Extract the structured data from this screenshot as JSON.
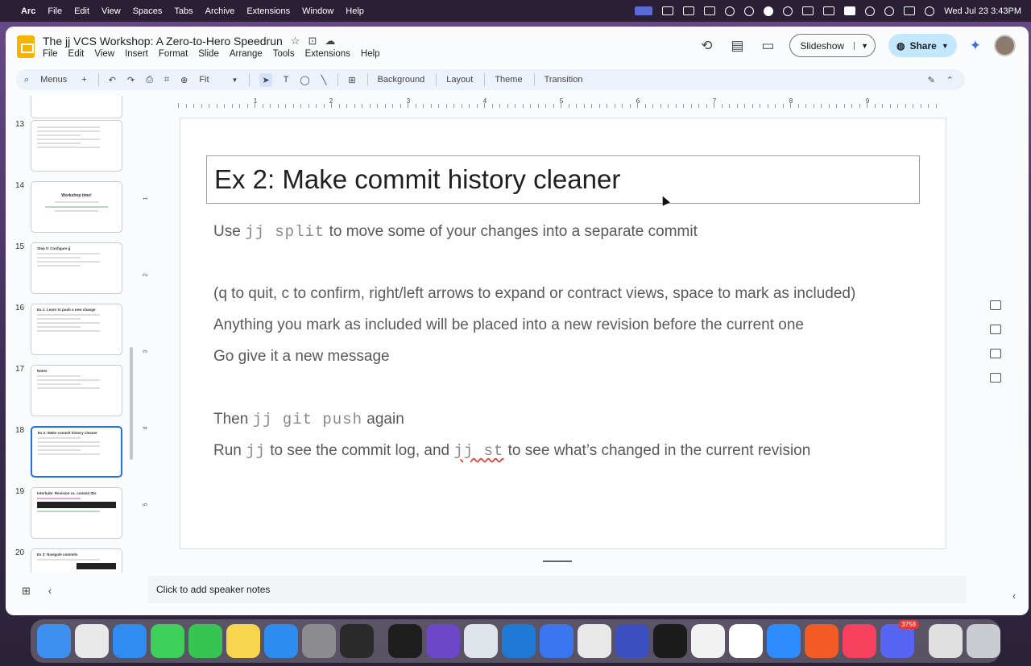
{
  "menubar": {
    "app_name": "Arc",
    "items": [
      "File",
      "Edit",
      "View",
      "Spaces",
      "Tabs",
      "Archive",
      "Extensions",
      "Window",
      "Help"
    ],
    "datetime": "Wed Jul 23  3:43PM"
  },
  "doc": {
    "title": "The jj VCS Workshop: A Zero-to-Hero Speedrun",
    "menus": [
      "File",
      "Edit",
      "View",
      "Insert",
      "Format",
      "Slide",
      "Arrange",
      "Tools",
      "Extensions",
      "Help"
    ],
    "slideshow_label": "Slideshow",
    "share_label": "Share"
  },
  "toolbar": {
    "menus_label": "Menus",
    "zoom": "Fit",
    "background_label": "Background",
    "layout_label": "Layout",
    "theme_label": "Theme",
    "transition_label": "Transition"
  },
  "ruler": {
    "h_labels": [
      "1",
      "2",
      "3",
      "4",
      "5",
      "6",
      "7",
      "8",
      "9"
    ],
    "v_labels": [
      "1",
      "2",
      "3",
      "4",
      "5"
    ]
  },
  "filmstrip": [
    {
      "num": "13",
      "title": "",
      "lines": 6
    },
    {
      "num": "14",
      "title": "Workshop time!",
      "lines": 3
    },
    {
      "num": "15",
      "title": "Step 0: Configure jj",
      "lines": 4
    },
    {
      "num": "16",
      "title": "Ex 1: Learn to push a new change",
      "lines": 6
    },
    {
      "num": "17",
      "title": "Notes",
      "lines": 5
    },
    {
      "num": "18",
      "title": "Ex 2: Make commit history cleaner",
      "lines": 5
    },
    {
      "num": "19",
      "title": "Interlude: Revision vs. commit IDs",
      "lines": 3
    },
    {
      "num": "20",
      "title": "Ex 3: Navigate commits",
      "lines": 2
    }
  ],
  "slide": {
    "title": "Ex 2: Make commit history cleaner",
    "line1": {
      "pre": "Use ",
      "code": "jj split",
      "post": " to move some of your changes into a separate commit"
    },
    "line2": "(q to quit, c to confirm, right/left arrows to expand or contract views, space to mark as included)",
    "line3": "Anything you mark as included will be placed into a new revision before the current one",
    "line4": "Go give it a new message",
    "line5": {
      "pre": "Then ",
      "code": "jj git push",
      "post": " again"
    },
    "line6": {
      "pre": "Run ",
      "code1": "jj",
      "mid": " to see the commit log, and ",
      "code2": "jj st",
      "post": " to see what’s changed in the current revision"
    }
  },
  "notes": {
    "placeholder": "Click to add speaker notes"
  },
  "dock": {
    "discord_badge": "3758",
    "apps": [
      {
        "name": "finder-icon",
        "color": "#3d8ff0"
      },
      {
        "name": "launchpad-icon",
        "color": "#e8e8e8"
      },
      {
        "name": "safari-icon",
        "color": "#2f8cf0"
      },
      {
        "name": "messages-icon",
        "color": "#3ecf5a"
      },
      {
        "name": "facetime-icon",
        "color": "#36c553"
      },
      {
        "name": "notes-icon",
        "color": "#f7d64d"
      },
      {
        "name": "app-store-icon",
        "color": "#2d8cf0"
      },
      {
        "name": "system-settings-icon",
        "color": "#8d8d91"
      },
      {
        "name": "layers-app-icon",
        "color": "#2a2a2a"
      },
      {
        "name": "cube-app-icon",
        "color": "#1e1e1e"
      },
      {
        "name": "orb-app-icon",
        "color": "#6c48c9"
      },
      {
        "name": "scope-app-icon",
        "color": "#dfe4ea"
      },
      {
        "name": "vscode-icon",
        "color": "#1f7ad6"
      },
      {
        "name": "signal-icon",
        "color": "#3a76f0"
      },
      {
        "name": "chrome-icon",
        "color": "#e8e8e8"
      },
      {
        "name": "affinity-icon",
        "color": "#3b4fc0"
      },
      {
        "name": "terminal-icon",
        "color": "#1b1b1b"
      },
      {
        "name": "textedit-icon",
        "color": "#f2f2f2"
      },
      {
        "name": "notion-icon",
        "color": "#ffffff"
      },
      {
        "name": "zoom-icon",
        "color": "#2d8cff"
      },
      {
        "name": "brave-icon",
        "color": "#f25b23"
      },
      {
        "name": "music-icon",
        "color": "#f6405e"
      },
      {
        "name": "discord-icon",
        "color": "#5865f2"
      },
      {
        "name": "archive-utility-icon",
        "color": "#e0e0e0"
      },
      {
        "name": "trash-icon",
        "color": "#c9ccd1"
      }
    ]
  }
}
